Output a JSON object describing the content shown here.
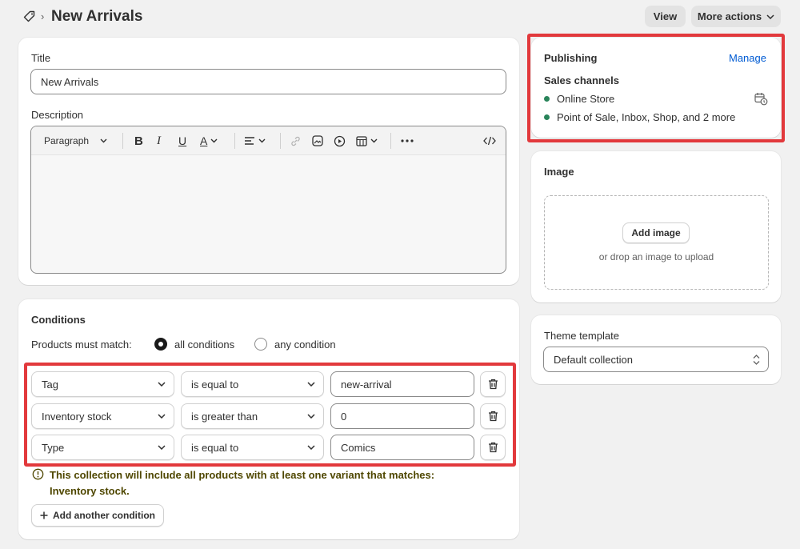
{
  "header": {
    "title": "New Arrivals",
    "view_label": "View",
    "more_actions_label": "More actions"
  },
  "form": {
    "title_label": "Title",
    "title_value": "New Arrivals",
    "description_label": "Description",
    "paragraph_label": "Paragraph"
  },
  "conditions": {
    "heading": "Conditions",
    "match_label": "Products must match:",
    "option_all": "all conditions",
    "option_any": "any condition",
    "selected": "all conditions",
    "rows": [
      {
        "field": "Tag",
        "operator": "is equal to",
        "value": "new-arrival"
      },
      {
        "field": "Inventory stock",
        "operator": "is greater than",
        "value": "0"
      },
      {
        "field": "Type",
        "operator": "is equal to",
        "value": "Comics"
      }
    ],
    "notice": "This collection will include all products with at least one variant that matches: Inventory stock.",
    "add_condition_label": "Add another condition"
  },
  "publishing": {
    "heading": "Publishing",
    "manage_label": "Manage",
    "sales_channels_label": "Sales channels",
    "channels": [
      "Online Store",
      "Point of Sale, Inbox, Shop, and 2 more"
    ]
  },
  "image_card": {
    "heading": "Image",
    "add_image_label": "Add image",
    "drop_hint": "or drop an image to upload"
  },
  "theme": {
    "label": "Theme template",
    "value": "Default collection"
  },
  "colors": {
    "highlight": "#e2393c",
    "link": "#005bd3",
    "status_dot": "#29845a",
    "notice_text": "#4f4700"
  }
}
